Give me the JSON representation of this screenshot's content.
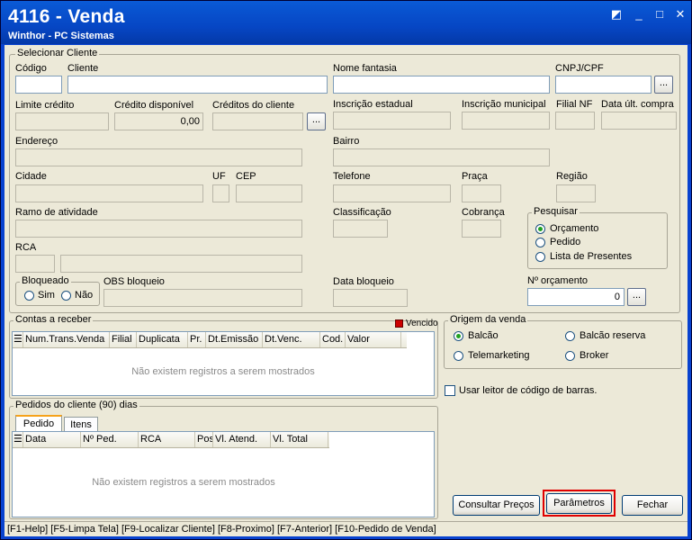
{
  "window": {
    "title": "4116 - Venda",
    "subtitle": "Winthor - PC Sistemas"
  },
  "cliente": {
    "group": "Selecionar Cliente",
    "codigo": "Código",
    "cliente": "Cliente",
    "nome_fantasia": "Nome fantasia",
    "cnpj": "CNPJ/CPF",
    "limite_credito": "Limite crédito",
    "credito_disponivel": "Crédito disponível",
    "credito_disponivel_value": "0,00",
    "creditos_cliente": "Créditos do cliente",
    "insc_estadual": "Inscrição estadual",
    "insc_municipal": "Inscrição municipal",
    "filial_nf": "Filial NF",
    "data_ult_compra": "Data últ. compra",
    "endereco": "Endereço",
    "bairro": "Bairro",
    "cidade": "Cidade",
    "uf": "UF",
    "cep": "CEP",
    "telefone": "Telefone",
    "praca": "Praça",
    "regiao": "Região",
    "ramo": "Ramo de atividade",
    "classificacao": "Classificação",
    "cobranca": "Cobrança",
    "rca": "RCA",
    "bloqueado": "Bloqueado",
    "sim": "Sim",
    "nao": "Não",
    "obs_bloqueio": "OBS bloqueio",
    "data_bloqueio": "Data bloqueio",
    "ellipsis": "..."
  },
  "pesquisar": {
    "title": "Pesquisar",
    "options": [
      "Orçamento",
      "Pedido",
      "Lista de Presentes"
    ],
    "selected": "Orçamento"
  },
  "orcamento": {
    "label": "Nº orçamento",
    "value": "0"
  },
  "contas": {
    "title": "Contas a receber",
    "legend": "Vencido",
    "legend_color": "#cc0000",
    "columns": [
      "Num.Trans.Venda",
      "Filial",
      "Duplicata",
      "Pr.",
      "Dt.Emissão",
      "Dt.Venc.",
      "Cod.",
      "Valor"
    ],
    "empty": "Não existem registros a serem mostrados"
  },
  "origem": {
    "title": "Origem da venda",
    "options": [
      "Balcão",
      "Balcão reserva",
      "Telemarketing",
      "Broker"
    ],
    "selected": "Balcão"
  },
  "leitor": {
    "label": "Usar leitor de código de barras."
  },
  "pedidos": {
    "title": "Pedidos do cliente (90) dias",
    "tabs": [
      "Pedido",
      "Itens"
    ],
    "active_tab": "Pedido",
    "columns": [
      "Data",
      "Nº Ped.",
      "RCA",
      "Pos",
      "Vl. Atend.",
      "Vl. Total"
    ],
    "empty": "Não existem registros a serem mostrados"
  },
  "buttons": {
    "consultar": "Consultar Preços",
    "parametros": "Parâmetros",
    "fechar": "Fechar",
    "highlight_color": "#e00000"
  },
  "status": "[F1-Help] [F5-Limpa Tela] [F9-Localizar Cliente] [F8-Proximo] [F7-Anterior] [F10-Pedido de Venda]"
}
